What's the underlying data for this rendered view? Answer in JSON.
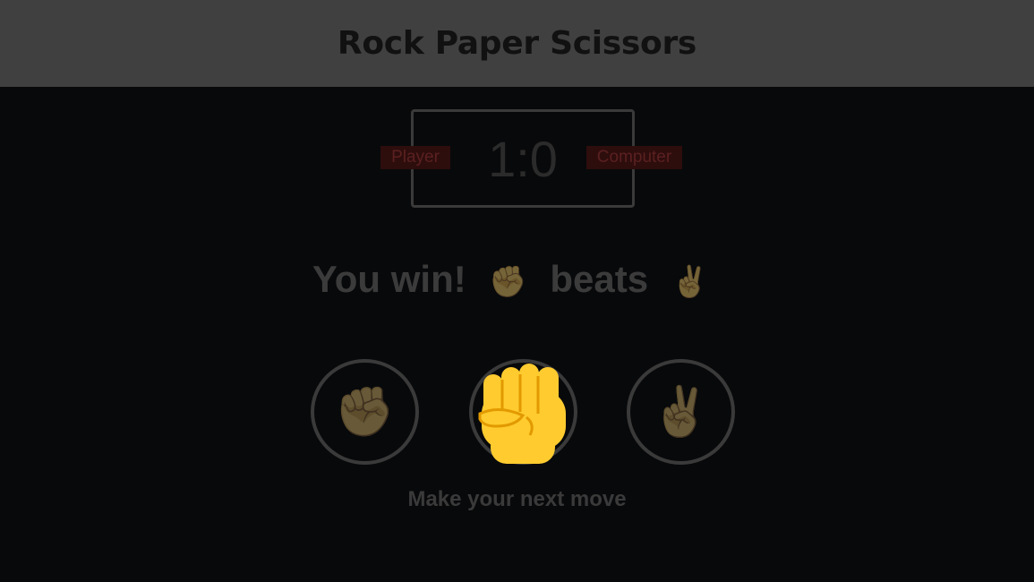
{
  "header": {
    "title": "Rock Paper Scissors"
  },
  "scoreboard": {
    "score": "1:0",
    "player_label": "Player",
    "computer_label": "Computer"
  },
  "result": {
    "text": "You win!",
    "player_move_icon": "✊",
    "verb": "beats",
    "computer_move_icon": "✌"
  },
  "choices": [
    {
      "name": "rock",
      "icon": "✊"
    },
    {
      "name": "paper",
      "icon": ""
    },
    {
      "name": "scissors",
      "icon": "✌"
    }
  ],
  "prompt": "Make your next move",
  "colors": {
    "header_bg": "#404040",
    "page_bg": "#08090b",
    "badge_bg": "#2e0d0d",
    "hand_yellow": "#ffcb2f",
    "hand_shadow": "#e29a00"
  }
}
